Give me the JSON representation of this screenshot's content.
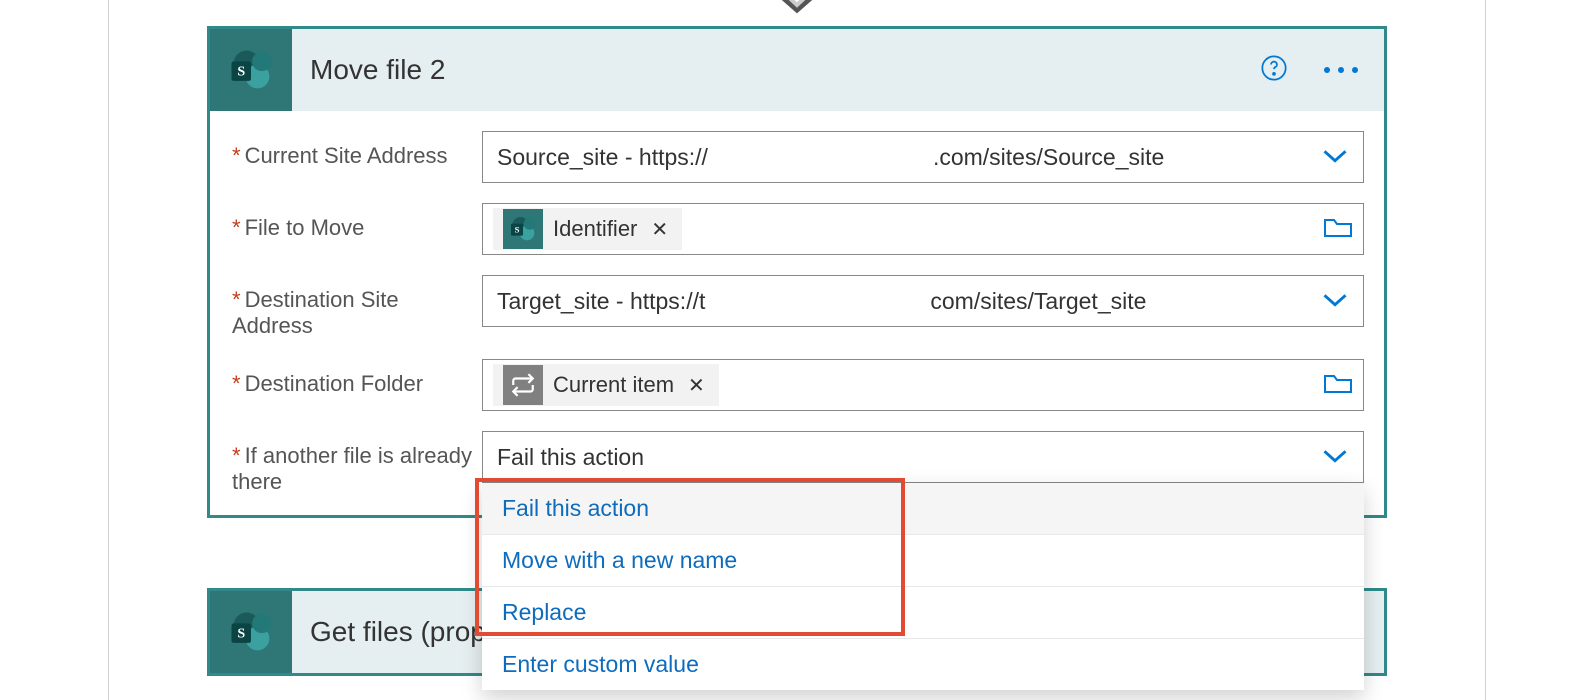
{
  "card1": {
    "title": "Move file 2",
    "rows": {
      "site_address": {
        "label": "Current Site Address",
        "value_start": "Source_site - https://",
        "value_end": ".com/sites/Source_site"
      },
      "file_to_move": {
        "label": "File to Move",
        "token": "Identifier"
      },
      "dest_site": {
        "label": "Destination Site Address",
        "value_start": "Target_site - https://t",
        "value_end": "com/sites/Target_site"
      },
      "dest_folder": {
        "label": "Destination Folder",
        "token": "Current item"
      },
      "already_there": {
        "label": "If another file is already there",
        "selected": "Fail this action",
        "options": [
          "Fail this action",
          "Move with a new name",
          "Replace",
          "Enter custom value"
        ]
      }
    }
  },
  "card2": {
    "title": "Get files (prope"
  }
}
